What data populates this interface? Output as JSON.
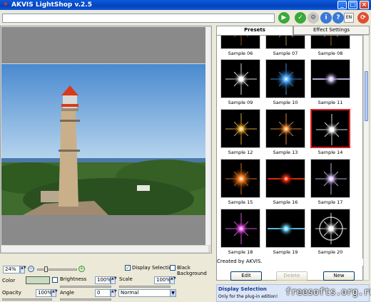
{
  "window": {
    "title": "AKVIS LightShop v.2.5"
  },
  "toolbar": {
    "path_value": "",
    "language": "EN"
  },
  "tabs": {
    "presets": "Presets",
    "effect_settings": "Effect Settings"
  },
  "presets": [
    {
      "label": "Sample 06",
      "color": "#a06020",
      "style": "rays"
    },
    {
      "label": "Sample 07",
      "color": "#c0a060",
      "style": "rays"
    },
    {
      "label": "Sample 08",
      "color": "#c08030",
      "style": "rays"
    },
    {
      "label": "Sample 09",
      "color": "#ffffff",
      "style": "star"
    },
    {
      "label": "Sample 10",
      "color": "#4aa8ff",
      "style": "burst"
    },
    {
      "label": "Sample 11",
      "color": "#d8c8ff",
      "style": "flare"
    },
    {
      "label": "Sample 12",
      "color": "#ffc040",
      "style": "star"
    },
    {
      "label": "Sample 13",
      "color": "#ff9a40",
      "style": "star"
    },
    {
      "label": "Sample 14",
      "color": "#ffffff",
      "style": "star"
    },
    {
      "label": "Sample 15",
      "color": "#ff8020",
      "style": "burst"
    },
    {
      "label": "Sample 16",
      "color": "#ff3010",
      "style": "flare"
    },
    {
      "label": "Sample 17",
      "color": "#e0c8ff",
      "style": "star"
    },
    {
      "label": "Sample 18",
      "color": "#ff60ff",
      "style": "star"
    },
    {
      "label": "Sample 19",
      "color": "#6ad8ff",
      "style": "flare"
    },
    {
      "label": "Sample 20",
      "color": "#ffffff",
      "style": "ring"
    }
  ],
  "selected_preset": "Sample 14",
  "created_by": "Created by AKVIS.",
  "buttons": {
    "edit": "Edit",
    "delete": "Delete",
    "new": "New"
  },
  "info": {
    "title": "Display Selection",
    "text": "Only for the plug-in edition!"
  },
  "controls": {
    "zoom": "24%",
    "display_selection": "Display Selection",
    "display_selection_checked": true,
    "black_background": "Black Background",
    "black_background_checked": false,
    "color_label": "Color",
    "color_value": "#c9dcc0",
    "brightness_label": "Brightness",
    "brightness_value": "100%",
    "scale_label": "Scale",
    "scale_value": "100%",
    "opacity_label": "Opacity",
    "opacity_value": "100%",
    "angle_label": "Angle",
    "angle_value": "0",
    "blend_mode": "Normal"
  },
  "watermark": "freesofts.org.ru"
}
